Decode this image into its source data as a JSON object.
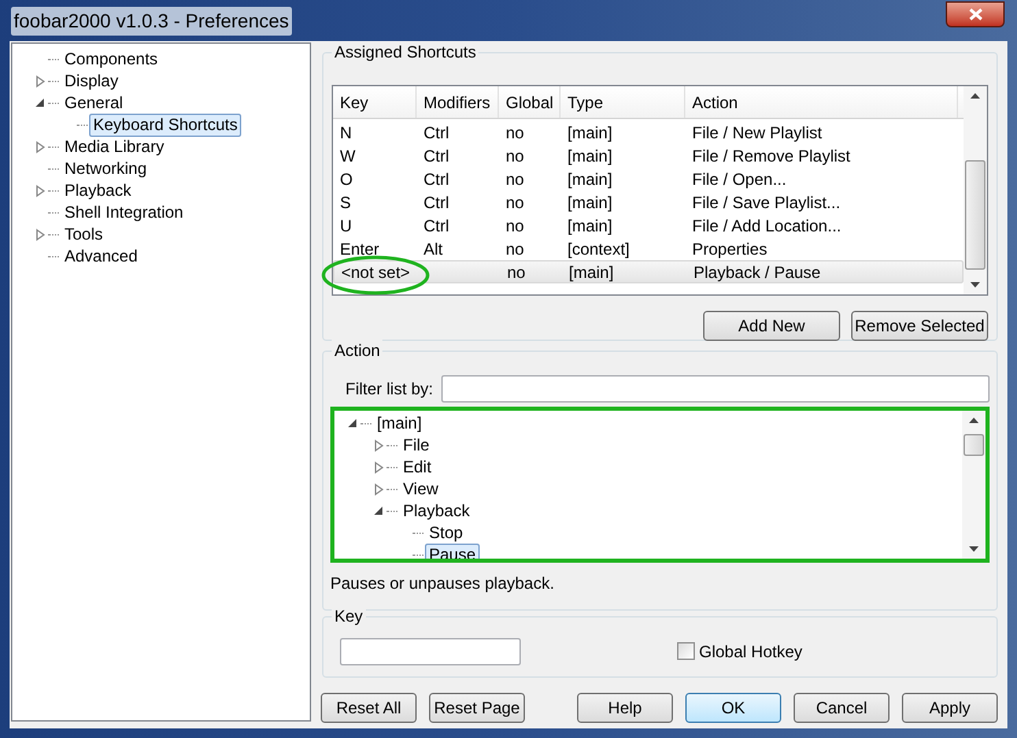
{
  "window": {
    "title": "foobar2000 v1.0.3 - Preferences"
  },
  "sidebar": {
    "items": [
      {
        "label": "Components",
        "kind": "leaf",
        "selected": false
      },
      {
        "label": "Display",
        "kind": "folder",
        "expanded": false,
        "selected": false
      },
      {
        "label": "General",
        "kind": "folder",
        "expanded": true,
        "selected": false,
        "children": [
          {
            "label": "Keyboard Shortcuts",
            "kind": "leaf",
            "selected": true
          }
        ]
      },
      {
        "label": "Media Library",
        "kind": "folder",
        "expanded": false,
        "selected": false
      },
      {
        "label": "Networking",
        "kind": "leaf",
        "selected": false
      },
      {
        "label": "Playback",
        "kind": "folder",
        "expanded": false,
        "selected": false
      },
      {
        "label": "Shell Integration",
        "kind": "leaf",
        "selected": false
      },
      {
        "label": "Tools",
        "kind": "folder",
        "expanded": false,
        "selected": false
      },
      {
        "label": "Advanced",
        "kind": "leaf",
        "selected": false
      }
    ]
  },
  "shortcuts": {
    "title": "Assigned Shortcuts",
    "columns": [
      "Key",
      "Modifiers",
      "Global",
      "Type",
      "Action"
    ],
    "rows": [
      {
        "cells": [
          "N",
          "Ctrl",
          "no",
          "[main]",
          "File / New Playlist"
        ],
        "selected": false
      },
      {
        "cells": [
          "W",
          "Ctrl",
          "no",
          "[main]",
          "File / Remove Playlist"
        ],
        "selected": false
      },
      {
        "cells": [
          "O",
          "Ctrl",
          "no",
          "[main]",
          "File / Open..."
        ],
        "selected": false
      },
      {
        "cells": [
          "S",
          "Ctrl",
          "no",
          "[main]",
          "File / Save Playlist..."
        ],
        "selected": false
      },
      {
        "cells": [
          "U",
          "Ctrl",
          "no",
          "[main]",
          "File / Add Location..."
        ],
        "selected": false
      },
      {
        "cells": [
          "Enter",
          "Alt",
          "no",
          "[context]",
          "Properties"
        ],
        "selected": false
      },
      {
        "cells": [
          "<not set>",
          "",
          "no",
          "[main]",
          "Playback / Pause"
        ],
        "selected": true
      }
    ],
    "buttons": [
      "Add New",
      "Remove Selected"
    ]
  },
  "action": {
    "title": "Action",
    "filter_label": "Filter list by:",
    "tree": [
      {
        "label": "[main]",
        "kind": "folder",
        "expanded": true,
        "selected": false,
        "children": [
          {
            "label": "File",
            "kind": "folder",
            "expanded": false,
            "selected": false
          },
          {
            "label": "Edit",
            "kind": "folder",
            "expanded": false,
            "selected": false
          },
          {
            "label": "View",
            "kind": "folder",
            "expanded": false,
            "selected": false
          },
          {
            "label": "Playback",
            "kind": "folder",
            "expanded": true,
            "selected": false,
            "children": [
              {
                "label": "Stop",
                "kind": "leaf",
                "selected": false
              },
              {
                "label": "Pause",
                "kind": "leaf",
                "selected": true
              }
            ]
          }
        ]
      }
    ],
    "description": "Pauses or unpauses playback."
  },
  "key": {
    "title": "Key",
    "global_hotkey": {
      "label": "Global Hotkey",
      "checked": false
    }
  },
  "footer": {
    "buttons": [
      {
        "label": "Reset All",
        "default": false
      },
      {
        "label": "Reset Page",
        "default": false
      },
      {
        "label": "Help",
        "default": false
      },
      {
        "label": "OK",
        "default": true
      },
      {
        "label": "Cancel",
        "default": false
      },
      {
        "label": "Apply",
        "default": false
      }
    ]
  }
}
